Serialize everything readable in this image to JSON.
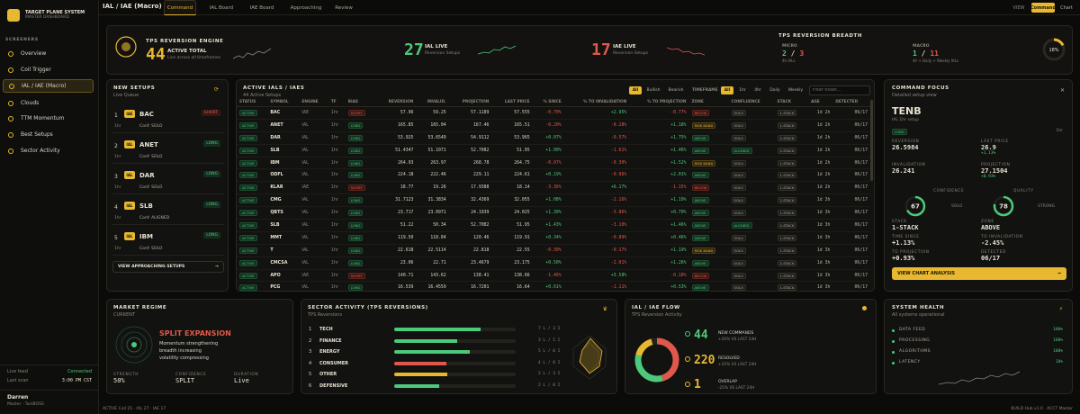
{
  "brand": {
    "title": "TARGET PLANE SYSTEM",
    "subtitle": "MASTER DASHBOARD"
  },
  "sidebar": {
    "section_label": "SCREENERS",
    "items": [
      {
        "label": "Overview",
        "icon": "grid-icon"
      },
      {
        "label": "Coil Trigger",
        "icon": "coil-icon"
      },
      {
        "label": "IAL / IAE (Macro)",
        "icon": "target-icon",
        "active": true
      },
      {
        "label": "Clouds",
        "icon": "cloud-icon"
      },
      {
        "label": "TTM Momentum",
        "icon": "momentum-icon"
      },
      {
        "label": "Best Setups",
        "icon": "star-icon"
      },
      {
        "label": "Sector Activity",
        "icon": "activity-icon"
      }
    ],
    "live_feed_label": "Live feed",
    "live_feed_value": "Connected",
    "last_scan_label": "Last scan",
    "last_scan_value": "3:00 PM CST",
    "user_name": "Darren",
    "user_role": "Master · TastBOSS"
  },
  "topbar": {
    "breadcrumb": "IAL / IAE (Macro)",
    "tabs": [
      "Command",
      "IAL Board",
      "IAE Board",
      "Approaching",
      "Review"
    ],
    "active_tab": "Command",
    "view_label": "VIEW",
    "command_btn": "Command",
    "chart_btn": "Chart"
  },
  "engine": {
    "title": "TPS REVERSION ENGINE",
    "total": "44",
    "total_label": "ACTIVE TOTAL",
    "total_sub": "Live across all timeframes",
    "ial_count": "27",
    "ial_label": "IAL LIVE",
    "ial_sub": "Reversion Setups",
    "iae_count": "17",
    "iae_label": "IAE LIVE",
    "iae_sub": "Reversion Setups",
    "breadth_title": "TPS REVERSION BREADTH",
    "micro_label": "MICRO",
    "micro_a": "2",
    "micro_sep": "/",
    "micro_b": "3",
    "micro_sub": "4h IALs",
    "macro_label": "MACRO",
    "macro_a": "1",
    "macro_sep": "/",
    "macro_b": "11",
    "macro_sub": "4h + Daily + Weekly IALs",
    "pct": "18%",
    "pct_value": 0.18
  },
  "new_setups": {
    "title": "NEW SETUPS",
    "subtitle": "Live Queue",
    "items": [
      {
        "n": "1",
        "tag": "IAE",
        "sym": "BAC",
        "side": "SHORT",
        "tf": "1hr",
        "conf": "Conf: SOLO"
      },
      {
        "n": "2",
        "tag": "IAL",
        "sym": "ANET",
        "side": "LONG",
        "tf": "1hr",
        "conf": "Conf: SOLO"
      },
      {
        "n": "3",
        "tag": "IAL",
        "sym": "DAR",
        "side": "LONG",
        "tf": "1hr",
        "conf": "Conf: SOLO"
      },
      {
        "n": "4",
        "tag": "IAL",
        "sym": "SLB",
        "side": "LONG",
        "tf": "1hr",
        "conf": "Conf: ALIGNED"
      },
      {
        "n": "5",
        "tag": "IAL",
        "sym": "IBM",
        "side": "LONG",
        "tf": "1hr",
        "conf": "Conf: SOLO"
      }
    ],
    "view_btn": "VIEW APPROACHING SETUPS"
  },
  "active_table": {
    "title": "ACTIVE IALS / IAES",
    "subtitle": "44 Active Setups",
    "side_filters": [
      "All",
      "Bullish",
      "Bearish"
    ],
    "timeframe_label": "TIMEFRAME",
    "tf_filters": [
      "All",
      "1hr",
      "4hr",
      "Daily",
      "Weekly"
    ],
    "filter_placeholder": "Filter ticker...",
    "columns": [
      "STATUS",
      "SYMBOL",
      "ENGINE",
      "TF",
      "BIAS",
      "REVERSION",
      "INVALID.",
      "PROJECTION",
      "LAST PRICE",
      "% SINCE",
      "% TO INVALIDATION",
      "% TO PROJECTION",
      "ZONE",
      "CONFLUENCE",
      "STACK",
      "AGE",
      "DETECTED"
    ],
    "rows": [
      [
        "ACTIVE",
        "BAC",
        "IAE",
        "1hr",
        "SHORT",
        "57.96",
        "59.25",
        "57.1189",
        "57.555",
        "-0.70%",
        "+2.95%",
        "-0.77%",
        "BELOW",
        "SOLO",
        "1-STACK",
        "1d 2h",
        "06/17"
      ],
      [
        "ACTIVE",
        "ANET",
        "IAL",
        "1hr",
        "LONG",
        "165.85",
        "165.04",
        "167.46",
        "165.51",
        "-0.20%",
        "-0.28%",
        "+1.18%",
        "RISK BAND",
        "SOLO",
        "1-STACK",
        "1d 2h",
        "06/17"
      ],
      [
        "ACTIVE",
        "DAR",
        "IAL",
        "1hr",
        "LONG",
        "53.925",
        "53.6549",
        "54.9112",
        "53.965",
        "+0.07%",
        "-0.57%",
        "+1.75%",
        "ABOVE",
        "SOLO",
        "2-STACK",
        "1d 2h",
        "06/17"
      ],
      [
        "ACTIVE",
        "SLB",
        "IAL",
        "1hr",
        "LONG",
        "51.4347",
        "51.1071",
        "52.7082",
        "51.95",
        "+1.00%",
        "-1.62%",
        "+1.46%",
        "ABOVE",
        "ALIGNED",
        "2-STACK",
        "1d 2h",
        "06/17"
      ],
      [
        "ACTIVE",
        "IBM",
        "IAL",
        "1hr",
        "LONG",
        "264.93",
        "263.97",
        "268.78",
        "264.75",
        "-0.07%",
        "-0.30%",
        "+1.52%",
        "RISK BAND",
        "SOLO",
        "1-STACK",
        "1d 2h",
        "06/17"
      ],
      [
        "ACTIVE",
        "ODFL",
        "IAL",
        "1hr",
        "LONG",
        "224.18",
        "222.46",
        "229.11",
        "224.61",
        "+0.19%",
        "-0.96%",
        "+2.01%",
        "ABOVE",
        "SOLO",
        "1-STACK",
        "1d 2h",
        "06/17"
      ],
      [
        "ACTIVE",
        "KLAR",
        "IAE",
        "1hr",
        "SHORT",
        "18.77",
        "19.26",
        "17.9388",
        "18.14",
        "-3.36%",
        "+6.17%",
        "-1.15%",
        "BELOW",
        "SOLO",
        "1-STACK",
        "1d 2h",
        "06/17"
      ],
      [
        "ACTIVE",
        "CMG",
        "IAL",
        "1hr",
        "LONG",
        "31.7123",
        "31.3834",
        "32.4369",
        "32.055",
        "+1.08%",
        "-2.16%",
        "+1.19%",
        "ABOVE",
        "SOLO",
        "2-STACK",
        "1d 3h",
        "06/17"
      ],
      [
        "ACTIVE",
        "QBTS",
        "IAL",
        "1hr",
        "LONG",
        "23.717",
        "23.0971",
        "24.1939",
        "24.025",
        "+1.30%",
        "-3.86%",
        "+0.70%",
        "ABOVE",
        "SOLO",
        "1-STACK",
        "1d 3h",
        "06/17"
      ],
      [
        "ACTIVE",
        "SLB",
        "IAL",
        "1hr",
        "LONG",
        "51.22",
        "50.34",
        "52.7082",
        "51.95",
        "+1.43%",
        "-3.10%",
        "+1.46%",
        "ABOVE",
        "ALIGNED",
        "2-STACK",
        "1d 3h",
        "06/17"
      ],
      [
        "ACTIVE",
        "MMT",
        "IAL",
        "1hr",
        "LONG",
        "119.50",
        "118.84",
        "120.46",
        "119.91",
        "+0.34%",
        "-0.89%",
        "+0.46%",
        "ABOVE",
        "SOLO",
        "1-STACK",
        "1d 3h",
        "06/17"
      ],
      [
        "ACTIVE",
        "T",
        "IAL",
        "1hr",
        "LONG",
        "22.618",
        "22.5114",
        "22.818",
        "22.55",
        "-0.30%",
        "-0.17%",
        "+1.19%",
        "RISK BAND",
        "SOLO",
        "1-STACK",
        "1d 3h",
        "06/17"
      ],
      [
        "ACTIVE",
        "CMCSA",
        "IAL",
        "1hr",
        "LONG",
        "23.06",
        "22.71",
        "23.4679",
        "23.175",
        "+0.50%",
        "-2.01%",
        "+1.26%",
        "ABOVE",
        "SOLO",
        "2-STACK",
        "1d 3h",
        "06/17"
      ],
      [
        "ACTIVE",
        "APO",
        "IAE",
        "1hr",
        "SHORT",
        "140.71",
        "143.62",
        "138.41",
        "138.66",
        "-1.46%",
        "+3.58%",
        "-0.18%",
        "BELOW",
        "SOLO",
        "1-STACK",
        "1d 3h",
        "06/17"
      ],
      [
        "ACTIVE",
        "PCG",
        "IAL",
        "1hr",
        "LONG",
        "16.539",
        "16.4559",
        "16.7201",
        "16.64",
        "+0.61%",
        "-1.11%",
        "+0.53%",
        "ABOVE",
        "SOLO",
        "1-STACK",
        "1d 3h",
        "06/17"
      ]
    ]
  },
  "focus": {
    "title": "COMMAND FOCUS",
    "subtitle": "Detailed setup view",
    "ticker": "TENB",
    "setup_desc": "IAL 1hr setup",
    "side": "LONG",
    "tf_badge": "1hr",
    "reversion_label": "REVERSION",
    "reversion": "26.5984",
    "last_price_label": "LAST PRICE",
    "last_price": "26.9",
    "last_price_chg": "+1.13%",
    "projection_label": "PROJECTION",
    "projection": "27.1504",
    "projection_chg": "+0.93%",
    "invalidation_label": "INVALIDATION",
    "invalidation": "26.241",
    "confidence_label": "CONFIDENCE",
    "confidence": "67",
    "confidence_value": 0.67,
    "confidence_tag": "SOLO",
    "quality_label": "QUALITY",
    "quality": "78",
    "quality_value": 0.78,
    "quality_tag": "STRONG",
    "stack_label": "STACK",
    "stack": "1-STACK",
    "zone_label": "ZONE",
    "zone": "ABOVE",
    "time_since_label": "TIME SINCE",
    "time_since": "+1.13%",
    "to_invalidation_label": "TO INVALIDATION",
    "to_invalidation": "-2.45%",
    "to_projection_label": "TO PROJECTION",
    "to_projection": "+0.93%",
    "detected_label": "DETECTED",
    "detected": "06/17",
    "view_btn": "VIEW CHART ANALYSIS"
  },
  "regime": {
    "title": "MARKET REGIME",
    "subtitle": "CURRENT",
    "name": "SPLIT EXPANSION",
    "desc1": "Momentum strengthening",
    "desc2": "breadth increasing",
    "desc3": "volatility compressing",
    "strength_label": "STRENGTH",
    "strength": "50%",
    "confidence_label": "CONFIDENCE",
    "confidence": "SPLIT",
    "duration_label": "DURATION",
    "duration": "Live"
  },
  "sector": {
    "title": "SECTOR ACTIVITY (TPS REVERSIONS)",
    "subtitle": "TPS Reversions",
    "rows": [
      {
        "n": "1",
        "name": "TECH",
        "value": 0.71,
        "color": "#4cc97a",
        "stat": "7 L / 3 I"
      },
      {
        "n": "2",
        "name": "FINANCE",
        "value": 0.52,
        "color": "#4cc97a",
        "stat": "3 L / 5 I"
      },
      {
        "n": "3",
        "name": "ENERGY",
        "value": 0.62,
        "color": "#4cc97a",
        "stat": "5 L / 0 I"
      },
      {
        "n": "4",
        "name": "CONSUMER",
        "value": 0.43,
        "color": "#e0584b",
        "stat": "4 L / 0 I"
      },
      {
        "n": "5",
        "name": "OTHER",
        "value": 0.44,
        "color": "#e8b830",
        "stat": "2 L / 3 I"
      },
      {
        "n": "6",
        "name": "DEFENSIVE",
        "value": 0.37,
        "color": "#4cc97a",
        "stat": "2 L / 0 I"
      }
    ]
  },
  "flow": {
    "title": "IAL / IAE FLOW",
    "subtitle": "TPS Reversion Activity",
    "new_count": "44",
    "new_label": "NEW COMMANDS",
    "new_sub": "+20% VS LAST 24H",
    "resolved_count": "220",
    "resolved_label": "RESOLVED",
    "resolved_sub": "+35% VS LAST 24H",
    "overlap_count": "1",
    "overlap_label": "OVERLAP",
    "overlap_sub": "-25% VS LAST 24H"
  },
  "health": {
    "title": "SYSTEM HEALTH",
    "subtitle": "All systems operational",
    "rows": [
      {
        "label": "DATA FEED",
        "value": "100%"
      },
      {
        "label": "PROCESSING",
        "value": "100%"
      },
      {
        "label": "ALGORITHMS",
        "value": "100%"
      },
      {
        "label": "LATENCY",
        "value": "18%"
      }
    ]
  },
  "footer": {
    "left": "ACTIVE  Coil 25  ·  IAL 27  ·  IAE 17",
    "right": "BUILD Hub v1.0  ·  ACCT Master"
  },
  "colors": {
    "accent": "#e8b830",
    "positive": "#4cc97a",
    "negative": "#e0584b",
    "background": "#0b0b0a"
  }
}
